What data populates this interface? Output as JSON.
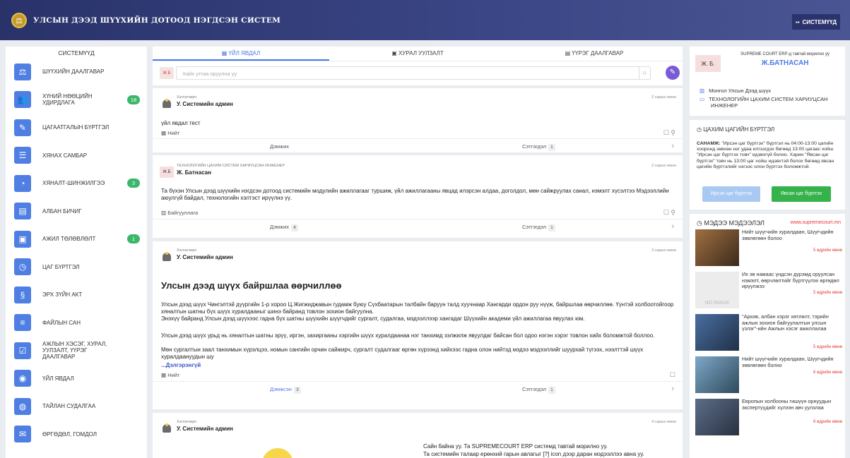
{
  "header": {
    "title": "УЛСЫН ДЭЭД ШҮҮХИЙН ДОТООД НЭГДСЭН СИСТЕМ",
    "systems_button": "СИСТЕМҮҮД"
  },
  "sidebar": {
    "title": "СИСТЕМҮҮД",
    "items": [
      {
        "label": "ШҮҮХИЙН ДААЛГАВАР",
        "icon": "gavel-icon",
        "glyph": "⚖"
      },
      {
        "label": "ХҮНИЙ НӨӨЦИЙН УДИРДЛАГА",
        "icon": "people-icon",
        "glyph": "👥",
        "badge": "18"
      },
      {
        "label": "ЦАГААТГАЛЫН БҮРТГЭЛ",
        "icon": "edit-doc-icon",
        "glyph": "✎"
      },
      {
        "label": "ХЯНАХ САМБАР",
        "icon": "dashboard-icon",
        "glyph": "☰"
      },
      {
        "label": "ХЯНАЛТ-ШИНЖИЛГЭЭ",
        "icon": "monitoring-icon",
        "glyph": "◔",
        "badge": "3"
      },
      {
        "label": "АЛБАН БИЧИГ",
        "icon": "document-icon",
        "glyph": "▤"
      },
      {
        "label": "АЖИЛ ТӨЛӨВЛӨЛТ",
        "icon": "briefcase-icon",
        "glyph": "▣",
        "badge": "1"
      },
      {
        "label": "ЦАГ БҮРТГЭЛ",
        "icon": "user-clock-icon",
        "glyph": "◷"
      },
      {
        "label": "ЭРХ ЗҮЙН АКТ",
        "icon": "law-doc-icon",
        "glyph": "§"
      },
      {
        "label": "ФАЙЛЫН САН",
        "icon": "database-icon",
        "glyph": "≡"
      },
      {
        "label": "АЖЛЫН ХЭСЭГ, ХУРАЛ, УУЛЗАЛТ, ҮҮРЭГ ДААЛГАВАР",
        "icon": "checklist-icon",
        "glyph": "☑"
      },
      {
        "label": "ҮЙЛ ЯВДАЛ",
        "icon": "event-doc-icon",
        "glyph": "◉"
      },
      {
        "label": "ТАЙЛАН СУДАЛГАА",
        "icon": "report-icon",
        "glyph": "◍"
      },
      {
        "label": "ӨРГӨДӨЛ, ГОМДОЛ",
        "icon": "complaint-icon",
        "glyph": "✉"
      }
    ]
  },
  "tabs": [
    {
      "label": "ҮЙЛ ЯВДАЛ",
      "icon": "calendar-icon"
    },
    {
      "label": "ХУРАЛ УУЛЗАЛТ",
      "icon": "meeting-icon"
    },
    {
      "label": "ҮҮРЭГ ДААЛГАВАР",
      "icon": "task-icon"
    }
  ],
  "search": {
    "avatar": "Ж.Б",
    "placeholder": "Хайх утгаа оруулна уу"
  },
  "posts": [
    {
      "role": "Хэглэгчирч",
      "name": "У. Системийн админ",
      "time": "2 сарын өмнө",
      "text": "үйл явдал тест",
      "tag": "Нийт",
      "like_label": "Дэмжих",
      "like_count": "",
      "view_label": "Сэтгэгдэл",
      "view_count": "1"
    },
    {
      "role": "ТЕХНОЛОГИЙН ЦАХИМ СИСТЕМ ХАРИУЦСАН ИНЖЕНЕР",
      "name": "Ж. Батнасан",
      "avatar": "Ж.Б",
      "time": "2 сарын өмнө",
      "text": "Та бүхэн Улсын дээд шүүхийн нэгдсэн дотоод системийн модулийн ажиллагааг туршиж, үйл ажиллагааны явцад илэрсэн алдаа, доголдол, мөн сайжруулах санал, нэмэлт хүсэлтээ Мэдээллийн аюулгүй байдал, технологийн хэлтэст ирүүлнэ үү.",
      "tag": "Байгууллага",
      "like_label": "Дэмжих",
      "like_count": "4",
      "view_label": "Сэтгэгдэл",
      "view_count": "1"
    },
    {
      "role": "Хэглэгчирч",
      "name": "У. Системийн админ",
      "time": "3 сарын өмнө",
      "heading": "Улсын дээд шүүх байршлаа өөрчиллөө",
      "p1": "Улсын дээд шүүх Чингэлтэй дүүргийн 1-р хороо Ц.Жигжиджавын гудамж буюу Сүхбаатарын талбайн баруун талд хуучнаар Хангарди ордон руу нүүж, байршлаа өөрчиллөө. Үүнтэй холбоотойгоор хяналтын шатны бүх шүүх хуралдааныг шинэ байранд товлон зохион байгуулна.",
      "p2": "Энэхүү байранд Улсын дээд шүүхээс гадна бүх шатны шүүхийн шүүгчдийг сургалт, судалгаа, мэдээллээр хангадаг Шүүхийн академи үйл ажиллагаа явуулах юм.",
      "p3": "Улсын дээд шүүх урьд нь хяналтын шатны эрүү, иргэн, захиргааны хэргийн шүүх хуралдаанаа нэг танхимд зэлжилж явуулдаг байсан бол одоо нэгэн хэрэг товлон хийх боломжтой боллоо.",
      "p4": "Мөн сургалтын заал танхимын хүрэлцээ, номын сангийн орчин сайжирч, сургалт судалгааг өргөн хүрээнд хийхээс гадна олон нийтэд мэдээ мэдээллийг шуурхай түгээх, нээлттэй шүүх хуралдаануудын шу",
      "more": "...Дэлгэрэнгүй",
      "tag": "Нийт",
      "like_label": "Дэмжсэн",
      "like_count": "3",
      "view_label": "Сэтгэгдэл",
      "view_count": "1"
    },
    {
      "role": "Хэглэгчирч",
      "name": "У. Системийн админ",
      "time": "4 сарын өмнө",
      "line1": "Сайн байна уу. Та SUPREMECOURT ERP системд тавтай морилно уу.",
      "line2": "Та системийн талаар ерөнхий гарын авлагыг [?] icon дээр даран мэдээллээ авна уу."
    }
  ],
  "profile": {
    "avatar": "Ж. Б.",
    "welcome": "SUPREME COURT ERP-д тавтай морилно уу",
    "name": "Ж.БАТНАСАН",
    "org": "Монгол Улсын Дээд шүүх",
    "position": "ТЕХНОЛОГИЙН ЦАХИМ СИСТЕМ ХАРИУЦСАН ИНЖЕНЕР"
  },
  "attendance": {
    "title": "ЦАХИМ ЦАГИЙН БҮРТГЭЛ",
    "notice_label": "САНАМЖ:",
    "notice": "\"Ирсэн цаг бүртгэх\" бүртгэл нь 04:00-13:00 цагийн хооронд зөвхөн нэг удаа илгээгдэх бөгөөд 13:00 цагаас хойш \"Ирсэн цаг бүртгэх товч\" идэвхгүй болно. Харин \"Явсан цаг бүртгэх\" товч нь 13:00 цаг хойш идэвхтэй болох бөгөөд явсан цагийн бүртгэлийг нэгээс олон бүртгэх боломжтой.",
    "in_button": "Ирсэн цаг бүртгэх",
    "out_button": "Явсан цаг бүртгэх"
  },
  "news": {
    "title": "МЭДЭЭ МЭДЭЭЛЭЛ",
    "site": "www.supremecourt.mn",
    "items": [
      {
        "title": "Нийт шүүгчийн хуралдаан, Шүүгчдийн зөвлөгөөн болоо",
        "time": "5 өдрийн өмнө"
      },
      {
        "title": "Их эв намаас үндсэн дүрэмд оруулсан нэмэлт, өөрчлөлтийг бүртгүүлэх өргөдөл ирүүлжээ",
        "time": "5 өдрийн өмнө",
        "img_label": "NO IMAGE"
      },
      {
        "title": "\"Архив, албан хэрэг хөтлөлт, тэрийн ажлын зохион байгуулалтын улсын үзлэг\"-ийн Ажлын хэсэг ажиллалаа",
        "time": "5 өдрийн өмнө"
      },
      {
        "title": "Нийт шүүгчийн хуралдаан, Шүүгчдийн зөвлөгөөн болно",
        "time": "6 өдрийн өмнө"
      },
      {
        "title": "Европын холбооны гишүүн орнуудын экспертүүдийг хүлээн авч уулзлаа",
        "time": "8 өдрийн өмнө"
      }
    ]
  }
}
